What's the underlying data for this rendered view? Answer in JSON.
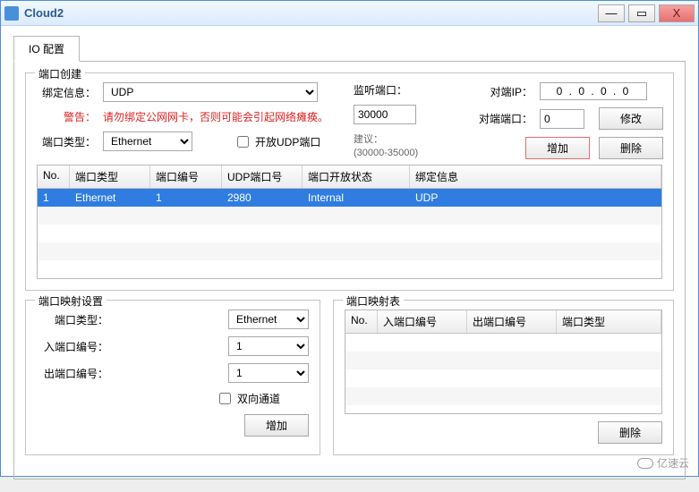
{
  "window": {
    "title": "Cloud2"
  },
  "tabs": {
    "io": "IO 配置"
  },
  "portCreate": {
    "legend": "端口创建",
    "bindInfoLabel": "绑定信息：",
    "bindInfoValue": "UDP",
    "warnLabel": "警告：",
    "warnText": "请勿绑定公网网卡，否则可能会引起网络瘫痪。",
    "portTypeLabel": "端口类型：",
    "portTypeValue": "Ethernet",
    "openUdpLabel": "开放UDP端口",
    "listenPortLabel": "监听端口：",
    "listenPortValue": "30000",
    "suggestLabel": "建议：",
    "suggestRange": "(30000-35000)",
    "peerIpLabel": "对端IP：",
    "peerIpValue": "0  .  0  .  0  .  0",
    "peerPortLabel": "对端端口：",
    "peerPortValue": "0",
    "modifyBtn": "修改",
    "addBtn": "增加",
    "deleteBtn": "删除",
    "headers": {
      "no": "No.",
      "type": "端口类型",
      "portNo": "端口编号",
      "udpNo": "UDP端口号",
      "openState": "端口开放状态",
      "bind": "绑定信息"
    },
    "rows": [
      {
        "no": "1",
        "type": "Ethernet",
        "portNo": "1",
        "udpNo": "2980",
        "openState": "Internal",
        "bind": "UDP"
      }
    ]
  },
  "portMap": {
    "legend": "端口映射设置",
    "portTypeLabel": "端口类型：",
    "portTypeValue": "Ethernet",
    "inPortLabel": "入端口编号：",
    "inPortValue": "1",
    "outPortLabel": "出端口编号：",
    "outPortValue": "1",
    "biDirLabel": "双向通道",
    "addBtn": "增加"
  },
  "mapTable": {
    "legend": "端口映射表",
    "headers": {
      "no": "No.",
      "in": "入端口编号",
      "out": "出端口编号",
      "type": "端口类型"
    },
    "deleteBtn": "删除"
  },
  "watermark": "亿速云"
}
